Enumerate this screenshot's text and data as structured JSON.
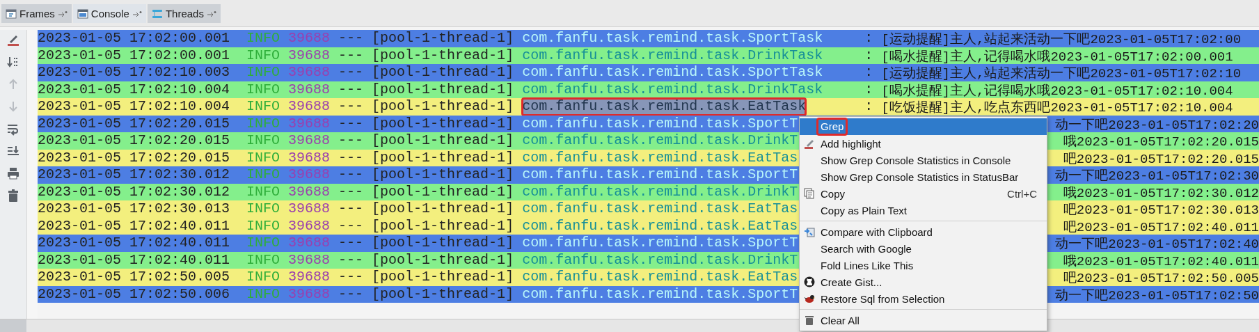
{
  "tabs": [
    {
      "kind": "frames",
      "label": "Frames",
      "selected": false
    },
    {
      "kind": "console",
      "label": "Console",
      "selected": true
    },
    {
      "kind": "threads",
      "label": "Threads",
      "selected": false
    }
  ],
  "toolbar": [
    {
      "kind": "highlight",
      "disabled": false
    },
    {
      "kind": "sort",
      "disabled": false
    },
    {
      "kind": "up",
      "disabled": true
    },
    {
      "kind": "down",
      "disabled": true
    },
    {
      "kind": "wrap",
      "disabled": false
    },
    {
      "kind": "scroll",
      "disabled": false
    },
    {
      "kind": "print",
      "disabled": false
    },
    {
      "kind": "trash",
      "disabled": false
    }
  ],
  "log": [
    {
      "color": "#4d7ee3",
      "time": "2023-01-05 17:02:00.001",
      "level": "INFO",
      "pid": "39688",
      "sep": "---",
      "thread": "[pool-1-thread-1]",
      "logger": "com.fanfu.task.remind.task.SportTask",
      "logger_selected": false,
      "colon": ":",
      "message": "[运动提醒]主人,站起来活动一下吧2023-01-05T17:02:00"
    },
    {
      "color": "#84ef8c",
      "time": "2023-01-05 17:02:00.001",
      "level": "INFO",
      "pid": "39688",
      "sep": "---",
      "thread": "[pool-1-thread-1]",
      "logger": "com.fanfu.task.remind.task.DrinkTask",
      "logger_selected": false,
      "colon": ":",
      "message": "[喝水提醒]主人,记得喝水哦2023-01-05T17:02:00.001"
    },
    {
      "color": "#4d7ee3",
      "time": "2023-01-05 17:02:10.003",
      "level": "INFO",
      "pid": "39688",
      "sep": "---",
      "thread": "[pool-1-thread-1]",
      "logger": "com.fanfu.task.remind.task.SportTask",
      "logger_selected": false,
      "colon": ":",
      "message": "[运动提醒]主人,站起来活动一下吧2023-01-05T17:02:10"
    },
    {
      "color": "#84ef8c",
      "time": "2023-01-05 17:02:10.004",
      "level": "INFO",
      "pid": "39688",
      "sep": "---",
      "thread": "[pool-1-thread-1]",
      "logger": "com.fanfu.task.remind.task.DrinkTask",
      "logger_selected": false,
      "colon": ":",
      "message": "[喝水提醒]主人,记得喝水哦2023-01-05T17:02:10.004"
    },
    {
      "color": "#f3ef7e",
      "time": "2023-01-05 17:02:10.004",
      "level": "INFO",
      "pid": "39688",
      "sep": "---",
      "thread": "[pool-1-thread-1]",
      "logger": "com.fanfu.task.remind.task.EatTask",
      "logger_selected": true,
      "colon": ":",
      "message": "[吃饭提醒]主人,吃点东西吧2023-01-05T17:02:10.004"
    },
    {
      "color": "#4d7ee3",
      "time": "2023-01-05 17:02:20.015",
      "level": "INFO",
      "pid": "39688",
      "sep": "---",
      "thread": "[pool-1-thread-1]",
      "logger": "com.fanfu.task.remind.task.SportT",
      "logger_selected": false,
      "message": "动一下吧2023-01-05T17:02:20"
    },
    {
      "color": "#84ef8c",
      "time": "2023-01-05 17:02:20.015",
      "level": "INFO",
      "pid": "39688",
      "sep": "---",
      "thread": "[pool-1-thread-1]",
      "logger": "com.fanfu.task.remind.task.DrinkT",
      "logger_selected": false,
      "message": "哦2023-01-05T17:02:20.015"
    },
    {
      "color": "#f3ef7e",
      "time": "2023-01-05 17:02:20.015",
      "level": "INFO",
      "pid": "39688",
      "sep": "---",
      "thread": "[pool-1-thread-1]",
      "logger": "com.fanfu.task.remind.task.EatTas",
      "logger_selected": false,
      "message": "吧2023-01-05T17:02:20.015"
    },
    {
      "color": "#4d7ee3",
      "time": "2023-01-05 17:02:30.012",
      "level": "INFO",
      "pid": "39688",
      "sep": "---",
      "thread": "[pool-1-thread-1]",
      "logger": "com.fanfu.task.remind.task.SportT",
      "logger_selected": false,
      "message": "动一下吧2023-01-05T17:02:30"
    },
    {
      "color": "#84ef8c",
      "time": "2023-01-05 17:02:30.012",
      "level": "INFO",
      "pid": "39688",
      "sep": "---",
      "thread": "[pool-1-thread-1]",
      "logger": "com.fanfu.task.remind.task.DrinkT",
      "logger_selected": false,
      "message": "哦2023-01-05T17:02:30.012"
    },
    {
      "color": "#f3ef7e",
      "time": "2023-01-05 17:02:30.013",
      "level": "INFO",
      "pid": "39688",
      "sep": "---",
      "thread": "[pool-1-thread-1]",
      "logger": "com.fanfu.task.remind.task.EatTas",
      "logger_selected": false,
      "message": "吧2023-01-05T17:02:30.013"
    },
    {
      "color": "#f3ef7e",
      "time": "2023-01-05 17:02:40.011",
      "level": "INFO",
      "pid": "39688",
      "sep": "---",
      "thread": "[pool-1-thread-1]",
      "logger": "com.fanfu.task.remind.task.EatTas",
      "logger_selected": false,
      "message": "吧2023-01-05T17:02:40.011"
    },
    {
      "color": "#4d7ee3",
      "time": "2023-01-05 17:02:40.011",
      "level": "INFO",
      "pid": "39688",
      "sep": "---",
      "thread": "[pool-1-thread-1]",
      "logger": "com.fanfu.task.remind.task.SportT",
      "logger_selected": false,
      "message": "动一下吧2023-01-05T17:02:40"
    },
    {
      "color": "#84ef8c",
      "time": "2023-01-05 17:02:40.011",
      "level": "INFO",
      "pid": "39688",
      "sep": "---",
      "thread": "[pool-1-thread-1]",
      "logger": "com.fanfu.task.remind.task.DrinkT",
      "logger_selected": false,
      "message": "哦2023-01-05T17:02:40.011"
    },
    {
      "color": "#f3ef7e",
      "time": "2023-01-05 17:02:50.005",
      "level": "INFO",
      "pid": "39688",
      "sep": "---",
      "thread": "[pool-1-thread-1]",
      "logger": "com.fanfu.task.remind.task.EatTas",
      "logger_selected": false,
      "message": "吧2023-01-05T17:02:50.005"
    },
    {
      "color": "#4d7ee3",
      "time": "2023-01-05 17:02:50.006",
      "level": "INFO",
      "pid": "39688",
      "sep": "---",
      "thread": "[pool-1-thread-1]",
      "logger": "com.fanfu.task.remind.task.SportT",
      "logger_selected": false,
      "message": "动一下吧2023-01-05T17:02:50"
    }
  ],
  "context_menu": {
    "items": [
      {
        "kind": "grep",
        "label": "Grep",
        "selected": true
      },
      {
        "kind": "highlight",
        "label": "Add highlight",
        "selected": false
      },
      {
        "kind": "plain",
        "label": "Show Grep Console Statistics in Console",
        "selected": false
      },
      {
        "kind": "plain",
        "label": "Show Grep Console Statistics in StatusBar",
        "selected": false
      },
      {
        "kind": "copy",
        "label": "Copy",
        "shortcut": "Ctrl+C",
        "selected": false
      },
      {
        "kind": "plain",
        "label": "Copy as Plain Text",
        "selected": false
      },
      {
        "kind": "separator"
      },
      {
        "kind": "compare",
        "label": "Compare with Clipboard",
        "selected": false
      },
      {
        "kind": "plain",
        "label": "Search with Google",
        "selected": false
      },
      {
        "kind": "plain",
        "label": "Fold Lines Like This",
        "selected": false
      },
      {
        "kind": "gist",
        "label": "Create Gist...",
        "selected": false
      },
      {
        "kind": "sql",
        "label": "Restore Sql from Selection",
        "selected": false
      },
      {
        "kind": "separator"
      },
      {
        "kind": "clear",
        "label": "Clear All",
        "selected": false
      }
    ]
  }
}
